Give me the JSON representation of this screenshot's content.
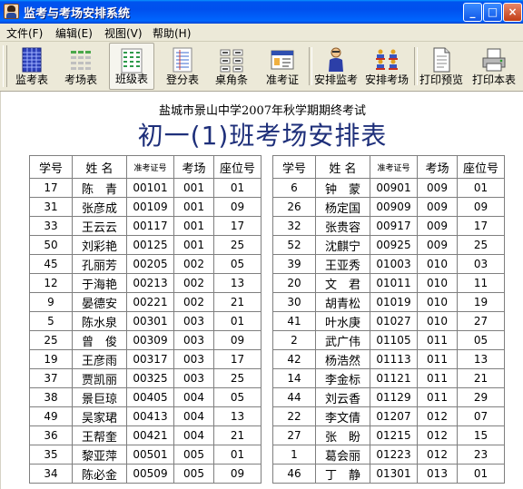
{
  "window": {
    "title": "监考与考场安排系统",
    "minimize": "_",
    "maximize": "□",
    "close": "×"
  },
  "menu": [
    {
      "label": "文件(F)"
    },
    {
      "label": "编辑(E)"
    },
    {
      "label": "视图(V)"
    },
    {
      "label": "帮助(H)"
    }
  ],
  "toolbar": [
    {
      "label": "监考表",
      "icon": "invigilator-table-icon"
    },
    {
      "label": "考场表",
      "icon": "exam-room-table-icon"
    },
    {
      "label": "班级表",
      "icon": "class-table-icon"
    },
    {
      "label": "登分表",
      "icon": "score-entry-icon"
    },
    {
      "label": "桌角条",
      "icon": "desk-label-icon"
    },
    {
      "label": "准考证",
      "icon": "admission-ticket-icon"
    },
    {
      "label": "安排监考",
      "icon": "assign-invigilator-icon"
    },
    {
      "label": "安排考场",
      "icon": "assign-room-icon"
    },
    {
      "label": "打印预览",
      "icon": "print-preview-icon"
    },
    {
      "label": "打印本表",
      "icon": "printer-icon"
    }
  ],
  "document": {
    "subtitle": "盐城市景山中学2007年秋学期期终考试",
    "title": "初一(1)班考场安排表",
    "headers": [
      "学号",
      "姓 名",
      "准考证号",
      "考场",
      "座位号"
    ],
    "left_rows": [
      [
        "17",
        "陈　青",
        "00101",
        "001",
        "01"
      ],
      [
        "31",
        "张彦成",
        "00109",
        "001",
        "09"
      ],
      [
        "33",
        "王云云",
        "00117",
        "001",
        "17"
      ],
      [
        "50",
        "刘彩艳",
        "00125",
        "001",
        "25"
      ],
      [
        "45",
        "孔丽芳",
        "00205",
        "002",
        "05"
      ],
      [
        "12",
        "于海艳",
        "00213",
        "002",
        "13"
      ],
      [
        "9",
        "晏德安",
        "00221",
        "002",
        "21"
      ],
      [
        "5",
        "陈水泉",
        "00301",
        "003",
        "01"
      ],
      [
        "25",
        "曾　俊",
        "00309",
        "003",
        "09"
      ],
      [
        "19",
        "王彦雨",
        "00317",
        "003",
        "17"
      ],
      [
        "37",
        "贾凯丽",
        "00325",
        "003",
        "25"
      ],
      [
        "38",
        "景巨琼",
        "00405",
        "004",
        "05"
      ],
      [
        "49",
        "吴家珺",
        "00413",
        "004",
        "13"
      ],
      [
        "36",
        "王帮奎",
        "00421",
        "004",
        "21"
      ],
      [
        "35",
        "黎亚萍",
        "00501",
        "005",
        "01"
      ],
      [
        "34",
        "陈必金",
        "00509",
        "005",
        "09"
      ]
    ],
    "right_rows": [
      [
        "6",
        "钟　蒙",
        "00901",
        "009",
        "01"
      ],
      [
        "26",
        "杨定国",
        "00909",
        "009",
        "09"
      ],
      [
        "32",
        "张贵容",
        "00917",
        "009",
        "17"
      ],
      [
        "52",
        "沈麒宁",
        "00925",
        "009",
        "25"
      ],
      [
        "39",
        "王亚秀",
        "01003",
        "010",
        "03"
      ],
      [
        "20",
        "文　君",
        "01011",
        "010",
        "11"
      ],
      [
        "30",
        "胡青松",
        "01019",
        "010",
        "19"
      ],
      [
        "41",
        "叶水庚",
        "01027",
        "010",
        "27"
      ],
      [
        "2",
        "武广伟",
        "01105",
        "011",
        "05"
      ],
      [
        "42",
        "杨浩然",
        "01113",
        "011",
        "13"
      ],
      [
        "14",
        "李金标",
        "01121",
        "011",
        "21"
      ],
      [
        "44",
        "刘云香",
        "01129",
        "011",
        "29"
      ],
      [
        "22",
        "李文倩",
        "01207",
        "012",
        "07"
      ],
      [
        "27",
        "张　盼",
        "01215",
        "012",
        "15"
      ],
      [
        "1",
        "葛会丽",
        "01223",
        "012",
        "23"
      ],
      [
        "46",
        "丁　静",
        "01301",
        "013",
        "01"
      ]
    ]
  },
  "colors": {
    "title_blue": "#1e2f7a",
    "titlebar": "#0054e3"
  }
}
